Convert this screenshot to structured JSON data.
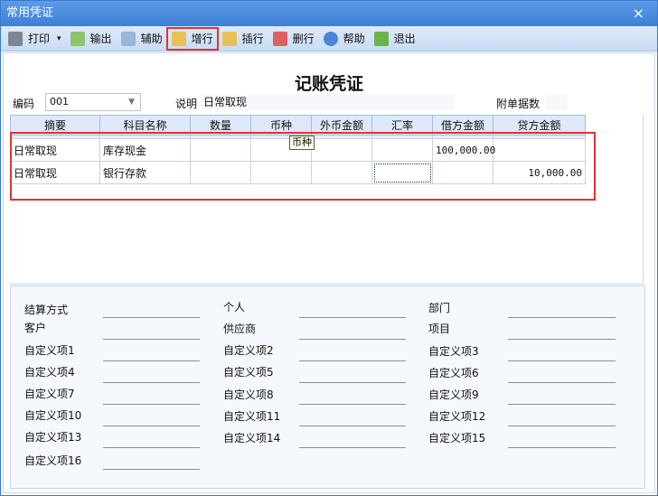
{
  "window": {
    "title": "常用凭证",
    "close": "×"
  },
  "toolbar": [
    {
      "label": "打印",
      "icon": "printer-icon",
      "dropdown": "▾"
    },
    {
      "label": "输出",
      "icon": "export-icon"
    },
    {
      "label": "辅助",
      "icon": "assist-icon"
    },
    {
      "label": "增行",
      "icon": "add-row-icon",
      "highlighted": true
    },
    {
      "label": "插行",
      "icon": "insert-row-icon"
    },
    {
      "label": "删行",
      "icon": "delete-row-icon"
    },
    {
      "label": "帮助",
      "icon": "help-icon"
    },
    {
      "label": "退出",
      "icon": "exit-icon"
    }
  ],
  "voucher": {
    "title": "记账凭证",
    "code_label": "编码",
    "code_value": "001",
    "desc_label": "说明",
    "desc_value": "日常取现",
    "attach_label": "附单据数",
    "attach_value": ""
  },
  "table": {
    "headers": [
      "摘要",
      "科目名称",
      "数量",
      "币种",
      "外币金额",
      "汇率",
      "借方金额",
      "贷方金额"
    ],
    "rows": [
      [
        "日常取现",
        "库存现金",
        "",
        "",
        "",
        "",
        "100,000.00",
        ""
      ],
      [
        "日常取现",
        "银行存款",
        "",
        "",
        "",
        "",
        "",
        "10,000.00"
      ]
    ],
    "tooltip": "币种"
  },
  "fields": {
    "col1": [
      "结算方式",
      "客户",
      "自定义项1",
      "自定义项4",
      "自定义项7",
      "自定义项10",
      "自定义项13",
      "自定义项16"
    ],
    "col2": [
      "个人",
      "供应商",
      "自定义项2",
      "自定义项5",
      "自定义项8",
      "自定义项11",
      "自定义项14"
    ],
    "col3": [
      "部门",
      "项目",
      "自定义项3",
      "自定义项6",
      "自定义项9",
      "自定义项12",
      "自定义项15"
    ]
  },
  "colors": {
    "title_bar": "#4a8ae0",
    "highlight": "#e5322f",
    "toolbar": "#d6e6f8"
  }
}
